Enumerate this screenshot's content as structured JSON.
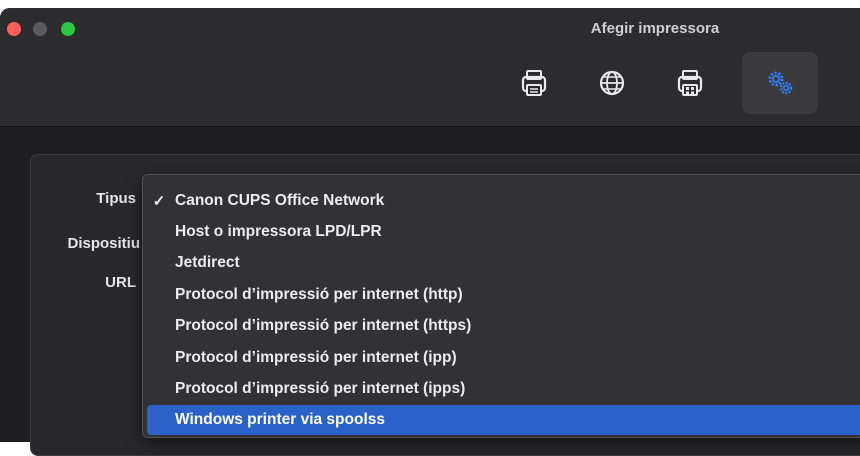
{
  "window": {
    "title": "Afegir impressora"
  },
  "toolbar": {
    "items": [
      {
        "name": "default-printer-icon"
      },
      {
        "name": "ip-globe-icon"
      },
      {
        "name": "windows-printer-icon"
      },
      {
        "name": "advanced-gears-icon",
        "selected": true
      }
    ]
  },
  "form": {
    "type_label": "Tipus",
    "device_label": "Dispositiu",
    "url_label": "URL"
  },
  "dropdown": {
    "checked_index": 0,
    "highlighted_index": 7,
    "options": [
      "Canon CUPS Office Network",
      "Host o impressora LPD/LPR",
      "Jetdirect",
      "Protocol d’impressió per internet (http)",
      "Protocol d’impressió per internet (https)",
      "Protocol d’impressió per internet (ipp)",
      "Protocol d’impressió per internet (ipps)",
      "Windows printer via spoolss"
    ],
    "check_glyph": "✓"
  },
  "colors": {
    "highlight": "#2a62c9",
    "toolbar_icon": "#e9e9eb",
    "gear_icon": "#2f7ef6"
  }
}
